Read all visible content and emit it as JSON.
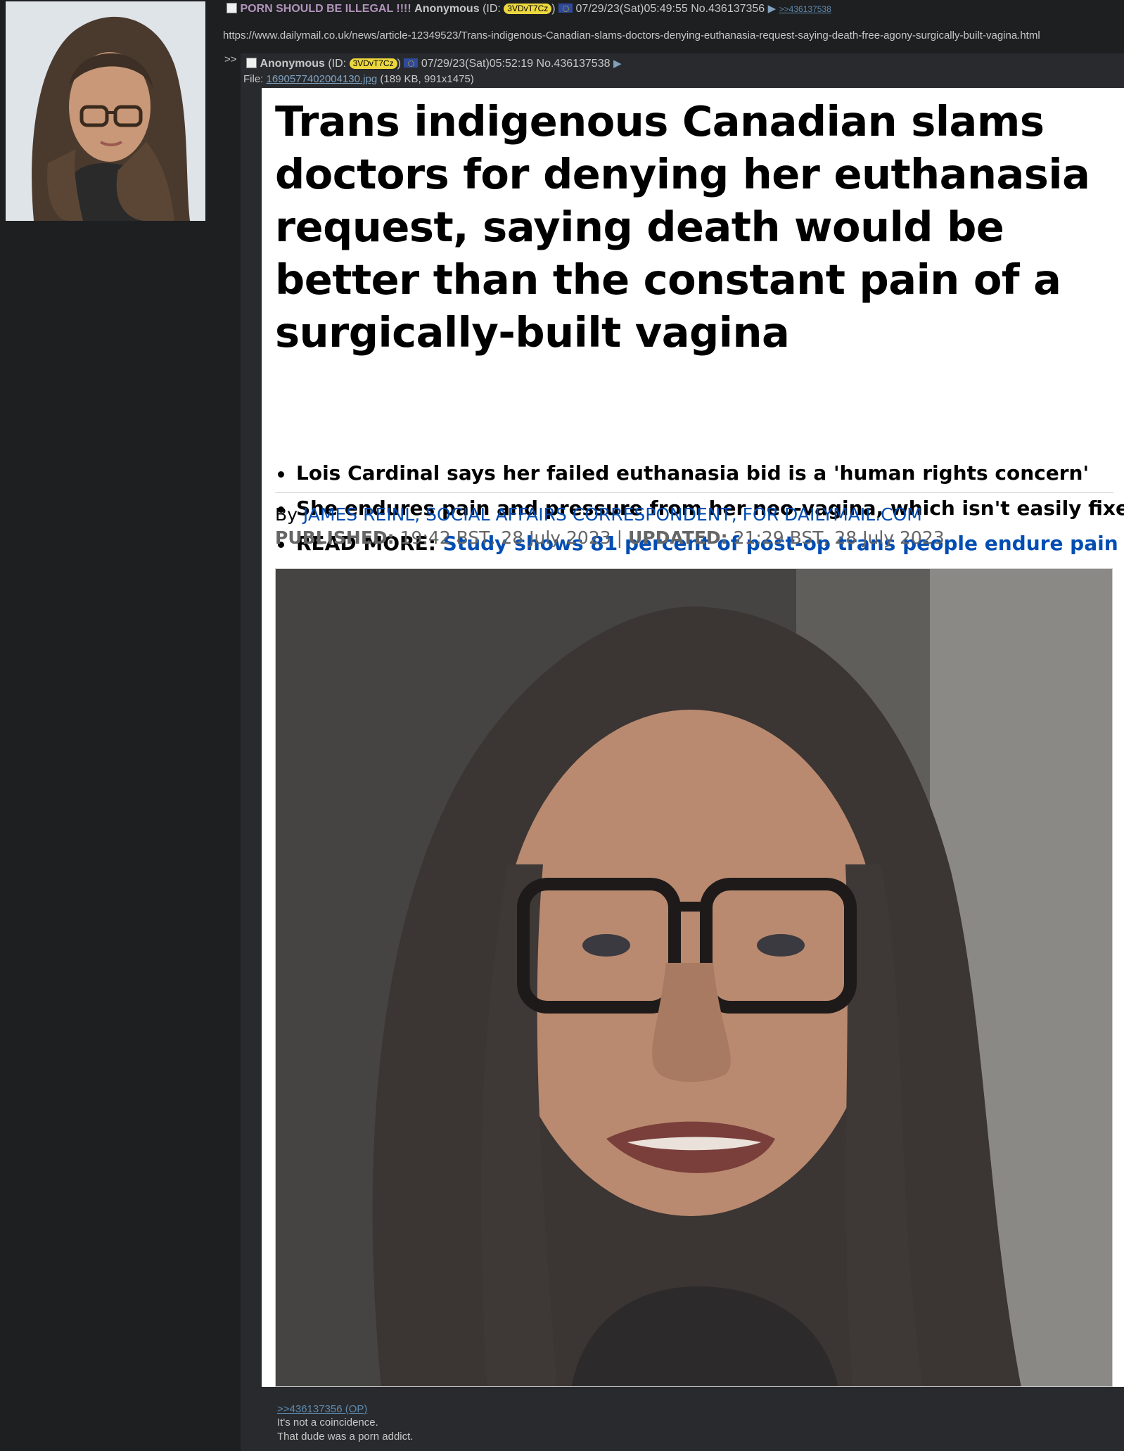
{
  "op": {
    "subject": "PORN SHOULD BE ILLEGAL !!!!",
    "name": "Anonymous",
    "id_prefix": "(ID: ",
    "id": "3VDvT7Cz",
    "id_suffix": ")",
    "datetime": "07/29/23(Sat)05:49:55",
    "post_number": "No.436137356",
    "backlink": ">>436137538",
    "comment": "https://www.dailymail.co.uk/news/article-12349523/Trans-indigenous-Canadian-slams-doctors-denying-euthanasia-request-saying-death-free-agony-surgically-built-vagina.html"
  },
  "reply": {
    "arrow": ">>",
    "name": "Anonymous",
    "id_prefix": "(ID: ",
    "id": "3VDvT7Cz",
    "id_suffix": ")",
    "datetime": "07/29/23(Sat)05:52:19",
    "post_number": "No.436137538",
    "file_label": "File: ",
    "file_name": "1690577402004130.jpg",
    "file_meta": "(189 KB, 991x1475)",
    "quote": ">>436137356 (OP)",
    "lines": [
      "It's not a coincidence.",
      "That dude was a porn addict."
    ]
  },
  "article": {
    "headline": "Trans indigenous Canadian slams doctors for denying her euthanasia request, saying death would be better than the constant pain of a surgically-built vagina",
    "bullets": [
      "Lois Cardinal says her failed euthanasia bid is a 'human rights concern'",
      "She endures pain and pressure from her neo-vagina, which isn't easily fixed"
    ],
    "readmore_label": "READ MORE:",
    "readmore_link": "Study shows 81 percent of post-op trans people endure pain",
    "byline_prefix": "By",
    "byline_author": "JAMES REINL, SOCIAL AFFAIRS CORRESPONDENT, FOR DAILYMAIL.COM",
    "published_label": "PUBLISHED:",
    "published_value": "19:42 BST, 28 July 2023",
    "separator": "|",
    "updated_label": "UPDATED:",
    "updated_value": "21:29 BST, 28 July 2023"
  },
  "icons": {
    "menu": "menu-arrow-icon",
    "flag": "eu-flag-icon",
    "checkbox": "checkbox-icon"
  },
  "colors": {
    "background": "#1d1f21",
    "reply_background": "#282a2e",
    "subject": "#b294bb",
    "link": "#5f89ac",
    "id_badge": "#ecd73e",
    "article_link": "#004db3"
  }
}
